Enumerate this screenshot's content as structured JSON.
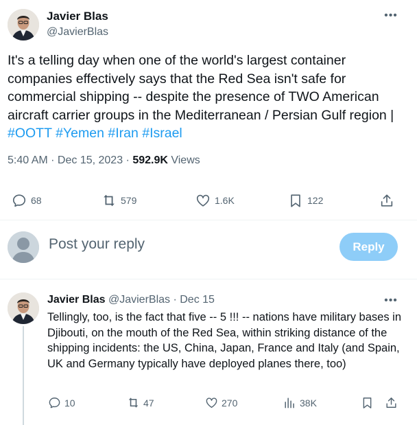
{
  "tweet": {
    "author_name": "Javier Blas",
    "author_handle": "@JavierBlas",
    "more_label": "•••",
    "text_plain": "It's a telling day when one of the world's largest container companies effectively says that the Red Sea isn't safe for commercial shipping -- despite the presence of TWO American aircraft carrier groups in the Mediterranean / Persian Gulf region | ",
    "hashtags": [
      "#OOTT",
      "#Yemen",
      "#Iran",
      "#Israel"
    ],
    "time": "5:40 AM · Dec 15, 2023 · ",
    "views_count": "592.9K",
    "views_label": " Views",
    "actions": {
      "replies": "68",
      "reposts": "579",
      "likes": "1.6K",
      "bookmarks": "122"
    }
  },
  "composer": {
    "placeholder": "Post your reply",
    "button_label": "Reply"
  },
  "reply": {
    "author_name": "Javier Blas",
    "author_handle": "@JavierBlas",
    "separator": " · ",
    "date": "Dec 15",
    "more_label": "•••",
    "text": "Tellingly, too, is the fact that five -- 5 !!! -- nations have military bases in Djibouti, on the mouth of the Red Sea, within striking distance of the shipping incidents: the US, China, Japan, France and Italy (and Spain, UK and Germany typically have deployed planes there, too)",
    "actions": {
      "replies": "10",
      "reposts": "47",
      "likes": "270",
      "views": "38K"
    }
  },
  "colors": {
    "link": "#1d9bf0",
    "secondary_text": "#536471",
    "reply_button_disabled": "#8ecdf8"
  }
}
